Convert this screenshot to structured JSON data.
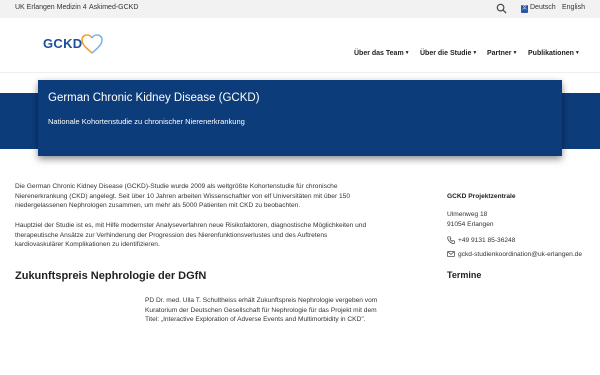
{
  "topbar": {
    "link1": "UK Erlangen Medizin 4",
    "link2": "Askimed-GCKD",
    "lang_de": "Deutsch",
    "lang_en": "English",
    "search_icon": "search-icon",
    "language_icon": "translate-icon"
  },
  "header": {
    "logo_text": "GCKD",
    "nav": [
      {
        "label": "Über das Team"
      },
      {
        "label": "Über die Studie"
      },
      {
        "label": "Partner"
      },
      {
        "label": "Publikationen"
      }
    ]
  },
  "hero": {
    "title": "German Chronic Kidney Disease (GCKD)",
    "subtitle": "Nationale Kohortenstudie zu chronischer Nierenerkrankung"
  },
  "main": {
    "para1_line1": "Die German Chronic Kidney Disease (GCKD)-Studie wurde 2009 als weltgrößte Kohortenstudie für chronische",
    "para1_line2": "Nierenerkrankung (CKD) angelegt. Seit über 10 Jahren arbeiten Wissenschaftler von elf Universitäten mit über 150",
    "para1_line3": "niedergelassenen Nephrologen zusammen, um mehr als 5000 Patienten mit CKD zu beobachten.",
    "para2_line1": "Hauptziel der Studie ist es, mit Hilfe modernster Analyseverfahren neue Risikofaktoren, diagnostische Möglichkeiten und",
    "para2_line2": "therapeutische Ansätze zur Verhinderung der Progression des Nierenfunktionsverlustes und des Auftretens",
    "para2_line3": "kardiovaskulärer Komplikationen zu identifizieren.",
    "section_title": "Zukunftspreis Nephrologie der DGfN",
    "award_line1": "PD Dr. med. Ulla T. Schultheiss erhält Zukunftspreis Nephrologie vergeben vom",
    "award_line2": "Kuratorium der Deutschen Gesellschaft für Nephrologie für das Projekt mit dem",
    "award_line3": "Titel: „Interactive Exploration of Adverse Events and Multimorbidity in CKD\"."
  },
  "sidebar": {
    "title": "GCKD Projektzentrale",
    "street": "Ulmenweg 18",
    "city": "91054 Erlangen",
    "phone": "+49 9131 85-36248",
    "email": "gckd-studienkoordination@uk-erlangen.de",
    "termine": "Termine",
    "phone_icon": "phone-icon",
    "mail_icon": "mail-icon"
  },
  "colors": {
    "brand_blue": "#0d3c7a",
    "logo_blue": "#1d4f9c",
    "logo_orange": "#f0a030"
  }
}
